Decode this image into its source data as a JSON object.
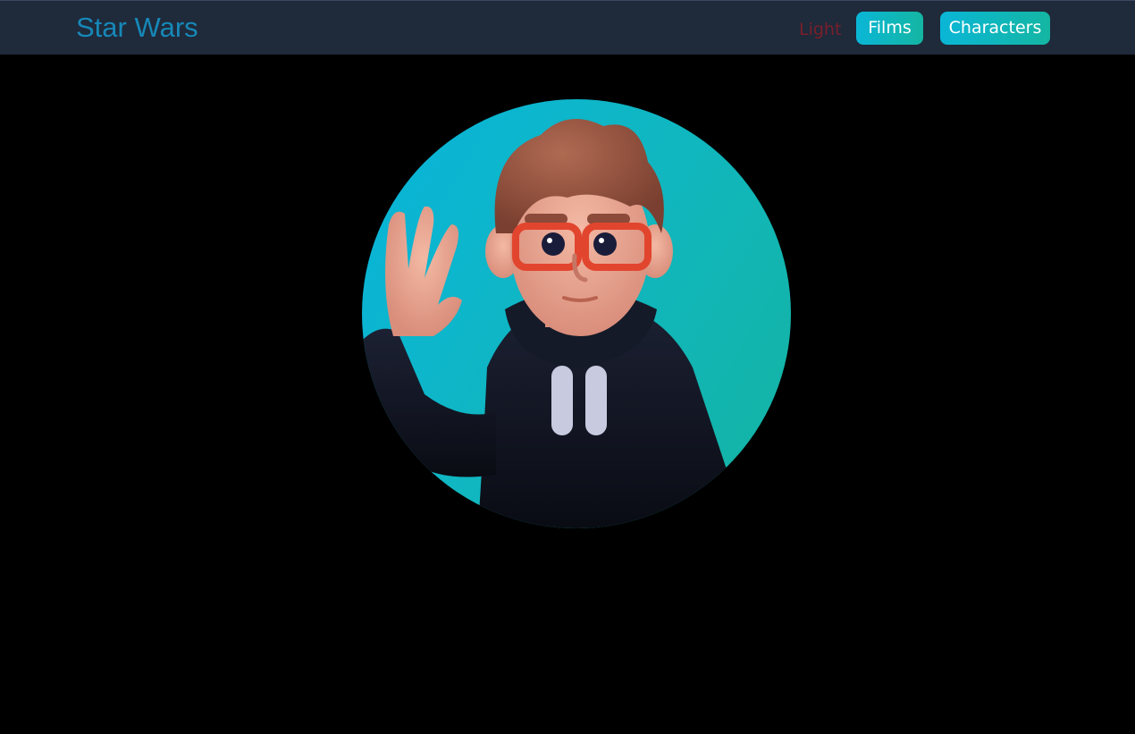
{
  "navbar": {
    "brand": "Star Wars",
    "theme_toggle": "Light",
    "buttons": {
      "films": "Films",
      "characters": "Characters"
    }
  },
  "hero": {
    "image": "avatar-illustration",
    "colors": {
      "gradient_start": "#08b4dc",
      "gradient_end": "#14b3a0"
    }
  },
  "colors": {
    "background": "#000000",
    "navbar": "#1f2a3b",
    "brand": "#1688b8",
    "theme_toggle": "#7a1f2a",
    "button_text": "#ffffff"
  }
}
